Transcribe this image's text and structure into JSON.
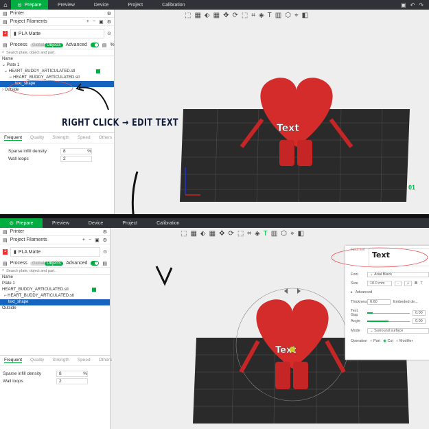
{
  "nav": {
    "tabs": [
      "Prepare",
      "Preview",
      "Device",
      "Project",
      "Calibration"
    ]
  },
  "left": {
    "printer": "Printer",
    "filaments": "Project Filaments",
    "filament_num": "1",
    "filament": "PLA Matte",
    "process": "Process",
    "global": "Global",
    "objects": "Objects",
    "advanced": "Advanced",
    "search_placeholder": "Search plate, object and part.",
    "tree": {
      "header": "Name",
      "plate": "Plate 1",
      "object": "HEART_BUDDY_ARTICULATED.stl",
      "part": "HEART_BUDDY_ARTICULATED.stl",
      "text": "text_shape",
      "outside": "Outside"
    },
    "tabs": [
      "Frequent",
      "Quality",
      "Strength",
      "Speed",
      "Others"
    ],
    "fields": [
      {
        "label": "Sparse infill density",
        "value": "8",
        "unit": "%"
      },
      {
        "label": "Wall loops",
        "value": "2"
      }
    ]
  },
  "annotation": {
    "text": "RIGHT CLICK → EDIT TEXT"
  },
  "model_text": "Text",
  "plate_number": "01",
  "text_panel": {
    "input_label": "Input text",
    "input_value": "Text",
    "font_label": "Font",
    "font": "Arial Black",
    "size_label": "Size",
    "size": "10.0 mm",
    "minus": "-",
    "plus": "+",
    "bold": "B",
    "italic": "T",
    "advanced": "Advanced",
    "thickness_label": "Thickness",
    "thickness": "0.60",
    "embed_label": "Embeded de...",
    "gap_label": "Text Gap",
    "gap": "0.00",
    "angle_label": "Angle",
    "angle": "0.00",
    "mode_label": "Mode",
    "mode": "Surround surface",
    "operation_label": "Operation",
    "ops": [
      "Part",
      "Cut",
      "Modifier"
    ],
    "op_selected": "Cut"
  },
  "colors": {
    "accent": "#00ae42",
    "selection": "#1565c0",
    "heart": "#d42b2b"
  }
}
